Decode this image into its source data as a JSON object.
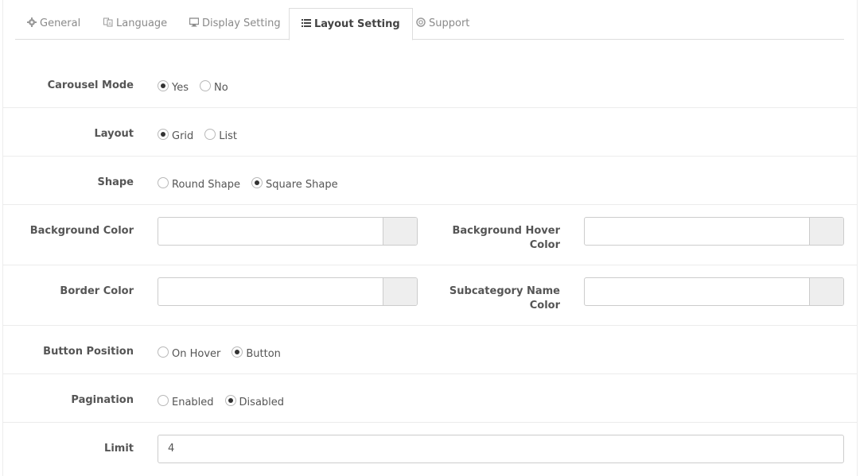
{
  "tabs": [
    {
      "label": "General",
      "icon": "gear-icon",
      "active": false
    },
    {
      "label": "Language",
      "icon": "language-icon",
      "active": false
    },
    {
      "label": "Display Setting",
      "icon": "desktop-icon",
      "active": false
    },
    {
      "label": "Layout Setting",
      "icon": "list-icon",
      "active": true
    },
    {
      "label": "Support",
      "icon": "life-ring-icon",
      "active": false
    }
  ],
  "carousel_mode": {
    "label": "Carousel Mode",
    "options": [
      "Yes",
      "No"
    ],
    "selected": "Yes"
  },
  "layout": {
    "label": "Layout",
    "options": [
      "Grid",
      "List"
    ],
    "selected": "Grid"
  },
  "shape": {
    "label": "Shape",
    "options": [
      "Round Shape",
      "Square Shape"
    ],
    "selected": "Square Shape"
  },
  "background_color": {
    "label": "Background Color",
    "value": ""
  },
  "background_hover_color": {
    "label_line1": "Background Hover",
    "label_line2": "Color",
    "value": ""
  },
  "border_color": {
    "label": "Border Color",
    "value": ""
  },
  "subcategory_name_color": {
    "label_line1": "Subcategory Name",
    "label_line2": "Color",
    "value": ""
  },
  "button_position": {
    "label": "Button Position",
    "options": [
      "On Hover",
      "Button"
    ],
    "selected": "Button"
  },
  "pagination": {
    "label": "Pagination",
    "options": [
      "Enabled",
      "Disabled"
    ],
    "selected": "Disabled"
  },
  "limit": {
    "label": "Limit",
    "value": "4"
  }
}
